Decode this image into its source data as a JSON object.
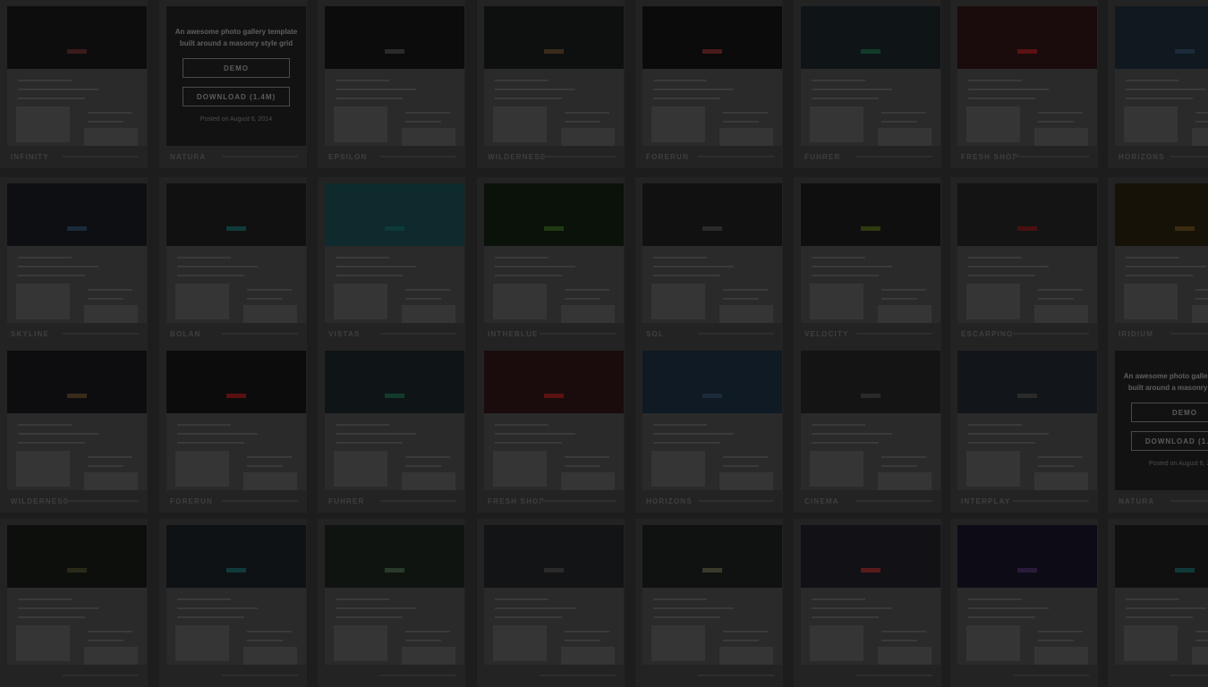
{
  "feature": {
    "tagline": "An awesome photo gallery template built around a masonry style grid",
    "demo_label": "DEMO",
    "download_label": "DOWNLOAD (1.4M)",
    "note": "Posted on August 6, 2014"
  },
  "templates": [
    {
      "name": "Infinity",
      "hero": "#0d0d0d",
      "accent": "#3a1a1a"
    },
    {
      "name": "Natura",
      "feature": true
    },
    {
      "name": "Epsilon",
      "hero": "#0c0c0c",
      "accent": "#2a2a2a"
    },
    {
      "name": "Wilderness",
      "hero": "#0e1010",
      "accent": "#3a2a1a"
    },
    {
      "name": "Forerun",
      "hero": "#0b0b0b",
      "accent": "#4a1a1a"
    },
    {
      "name": "Fuhrer",
      "hero": "#0f1417",
      "accent": "#123a2a"
    },
    {
      "name": "Fresh Shop",
      "hero": "#1a0c0c",
      "accent": "#5a1212"
    },
    {
      "name": "Horizons",
      "hero": "#101820",
      "accent": "#1c2a3a"
    },
    {
      "name": "Skyline",
      "hero": "#0d0f12",
      "accent": "#1a2a3a"
    },
    {
      "name": "Bolan",
      "hero": "#111111",
      "accent": "#103a3a"
    },
    {
      "name": "Vistas",
      "hero": "#0e2a2c",
      "accent": "#0e3a3a"
    },
    {
      "name": "Intheblue",
      "hero": "#0a120a",
      "accent": "#1f3a12"
    },
    {
      "name": "Sol",
      "hero": "#111111",
      "accent": "#2a2a2a"
    },
    {
      "name": "Velocity",
      "hero": "#0f0f0f",
      "accent": "#2f3a10"
    },
    {
      "name": "Escarpino",
      "hero": "#141414",
      "accent": "#4a1010"
    },
    {
      "name": "Iridium",
      "hero": "#161208",
      "accent": "#3a2a10"
    },
    {
      "name": "Wilderness",
      "hero": "#0d0d10",
      "accent": "#3a2a1a"
    },
    {
      "name": "Forerun",
      "hero": "#0c0c0c",
      "accent": "#5a1010"
    },
    {
      "name": "Fuhrer",
      "hero": "#0f1417",
      "accent": "#123a2a"
    },
    {
      "name": "Fresh Shop",
      "hero": "#1a0c0c",
      "accent": "#5a1212"
    },
    {
      "name": "Horizons",
      "hero": "#0f1a24",
      "accent": "#1c2a3a"
    },
    {
      "name": "Cinema",
      "hero": "#141414",
      "accent": "#2a2a2a"
    },
    {
      "name": "Interplay",
      "hero": "#12161a",
      "accent": "#2a2a2a"
    },
    {
      "name": "Natura",
      "feature": true
    },
    {
      "name": "",
      "hero": "#0d0f0c",
      "accent": "#2a2a1a"
    },
    {
      "name": "",
      "hero": "#0e1214",
      "accent": "#103a3a"
    },
    {
      "name": "",
      "hero": "#101410",
      "accent": "#2a3a2a"
    },
    {
      "name": "",
      "hero": "#121416",
      "accent": "#2a2a2a"
    },
    {
      "name": "",
      "hero": "#0f1210",
      "accent": "#3a3a2a"
    },
    {
      "name": "",
      "hero": "#111116",
      "accent": "#5a1a1a"
    },
    {
      "name": "",
      "hero": "#0d0c16",
      "accent": "#2a1a3a"
    },
    {
      "name": "",
      "hero": "#101010",
      "accent": "#103a3a"
    }
  ]
}
